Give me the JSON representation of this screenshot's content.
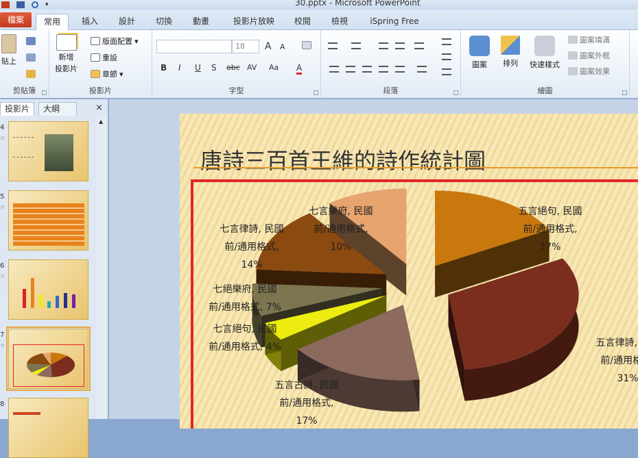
{
  "window": {
    "title": "30.pptx - Microsoft PowerPoint"
  },
  "tabs": [
    {
      "id": "file",
      "label": "檔案"
    },
    {
      "id": "home",
      "label": "常用"
    },
    {
      "id": "insert",
      "label": "插入"
    },
    {
      "id": "design",
      "label": "設計"
    },
    {
      "id": "transitions",
      "label": "切換"
    },
    {
      "id": "animations",
      "label": "動畫"
    },
    {
      "id": "slideshow",
      "label": "投影片放映"
    },
    {
      "id": "review",
      "label": "校閱"
    },
    {
      "id": "view",
      "label": "檢視"
    },
    {
      "id": "ispring",
      "label": "iSpring Free"
    }
  ],
  "ribbon": {
    "clipboard": {
      "label": "剪貼簿",
      "paste": "貼上"
    },
    "slides": {
      "label": "投影片",
      "new_slide_line1": "新增",
      "new_slide_line2": "投影片",
      "layout": "版面配置",
      "reset": "重設",
      "section": "章節"
    },
    "font": {
      "label": "字型",
      "size_value": "18",
      "bold": "B",
      "italic": "I",
      "underline": "U",
      "shadow": "S",
      "strike": "abc",
      "spacing": "AV",
      "case": "Aa",
      "color": "A",
      "grow": "A",
      "shrink": "A"
    },
    "paragraph": {
      "label": "段落"
    },
    "drawing": {
      "label": "繪圖",
      "shapes": "圖案",
      "arrange": "排列",
      "quick_styles": "快速樣式",
      "shape_fill": "圖案填滿",
      "shape_outline": "圖案外框",
      "shape_effects": "圖案效果"
    }
  },
  "panel": {
    "tab_slides": "投影片",
    "tab_outline": "大綱",
    "close": "×",
    "thumbnails": [
      {
        "num": "4",
        "star": "☆"
      },
      {
        "num": "5",
        "star": "☆"
      },
      {
        "num": "6",
        "star": "☆"
      },
      {
        "num": "7",
        "star": "☆"
      },
      {
        "num": "8",
        "star": ""
      }
    ]
  },
  "slide": {
    "title": "唐詩三百首王維的詩作統計圖"
  },
  "chart_data": {
    "type": "pie",
    "categories": [
      "五言絕句",
      "五言律詩",
      "五言古詩",
      "七言絕句",
      "七絕樂府",
      "七言律詩",
      "七言樂府"
    ],
    "values": [
      17,
      31,
      17,
      4,
      7,
      14,
      10
    ],
    "unit": "%",
    "colors": [
      "#c9780e",
      "#7b2e1d",
      "#8c6a5e",
      "#ecec10",
      "#7c7550",
      "#8b4a10",
      "#e8a46e"
    ],
    "labels": [
      [
        "五言絕句, 民國",
        "前/通用格式,",
        "17%"
      ],
      [
        "五言律詩, 民國",
        "前/通用格式,",
        "31%"
      ],
      [
        "五言古詩, 民國",
        "前/通用格式,",
        "17%"
      ],
      [
        "七言絕句, 民國",
        "前/通用格式, 4%"
      ],
      [
        "七絕樂府, 民國",
        "前/通用格式, 7%"
      ],
      [
        "七言律詩, 民國",
        "前/通用格式,",
        "14%"
      ],
      [
        "七言樂府, 民國",
        "前/通用格式,",
        "10%"
      ]
    ]
  }
}
